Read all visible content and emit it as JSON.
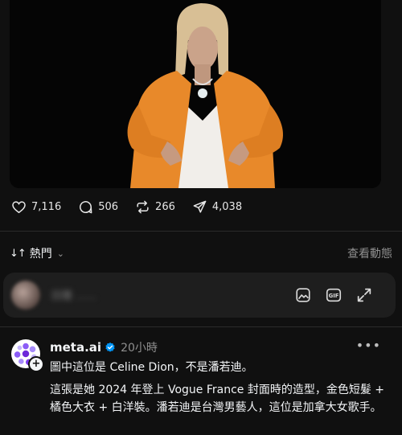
{
  "photo": {
    "description_icon": "portrait-photo"
  },
  "engagement": {
    "likes": "7,116",
    "replies": "506",
    "reposts": "266",
    "shares": "4,038"
  },
  "sort": {
    "arrows": "↓↑",
    "label": "熱門",
    "view_activity": "查看動態"
  },
  "reply_box": {
    "placeholder": "回覆 ……"
  },
  "post": {
    "author": "meta.ai",
    "time": "20小時",
    "line1": "圖中這位是 Celine Dion，不是潘若迪。",
    "line2": "這張是她 2024 年登上 Vogue France 封面時的造型，金色短髮 + 橘色大衣 + 白洋裝。潘若迪是台灣男藝人，這位是加拿大女歌手。"
  },
  "colors": {
    "background": "#101010",
    "coat": "#e8892a",
    "verified": "#0095f6"
  }
}
